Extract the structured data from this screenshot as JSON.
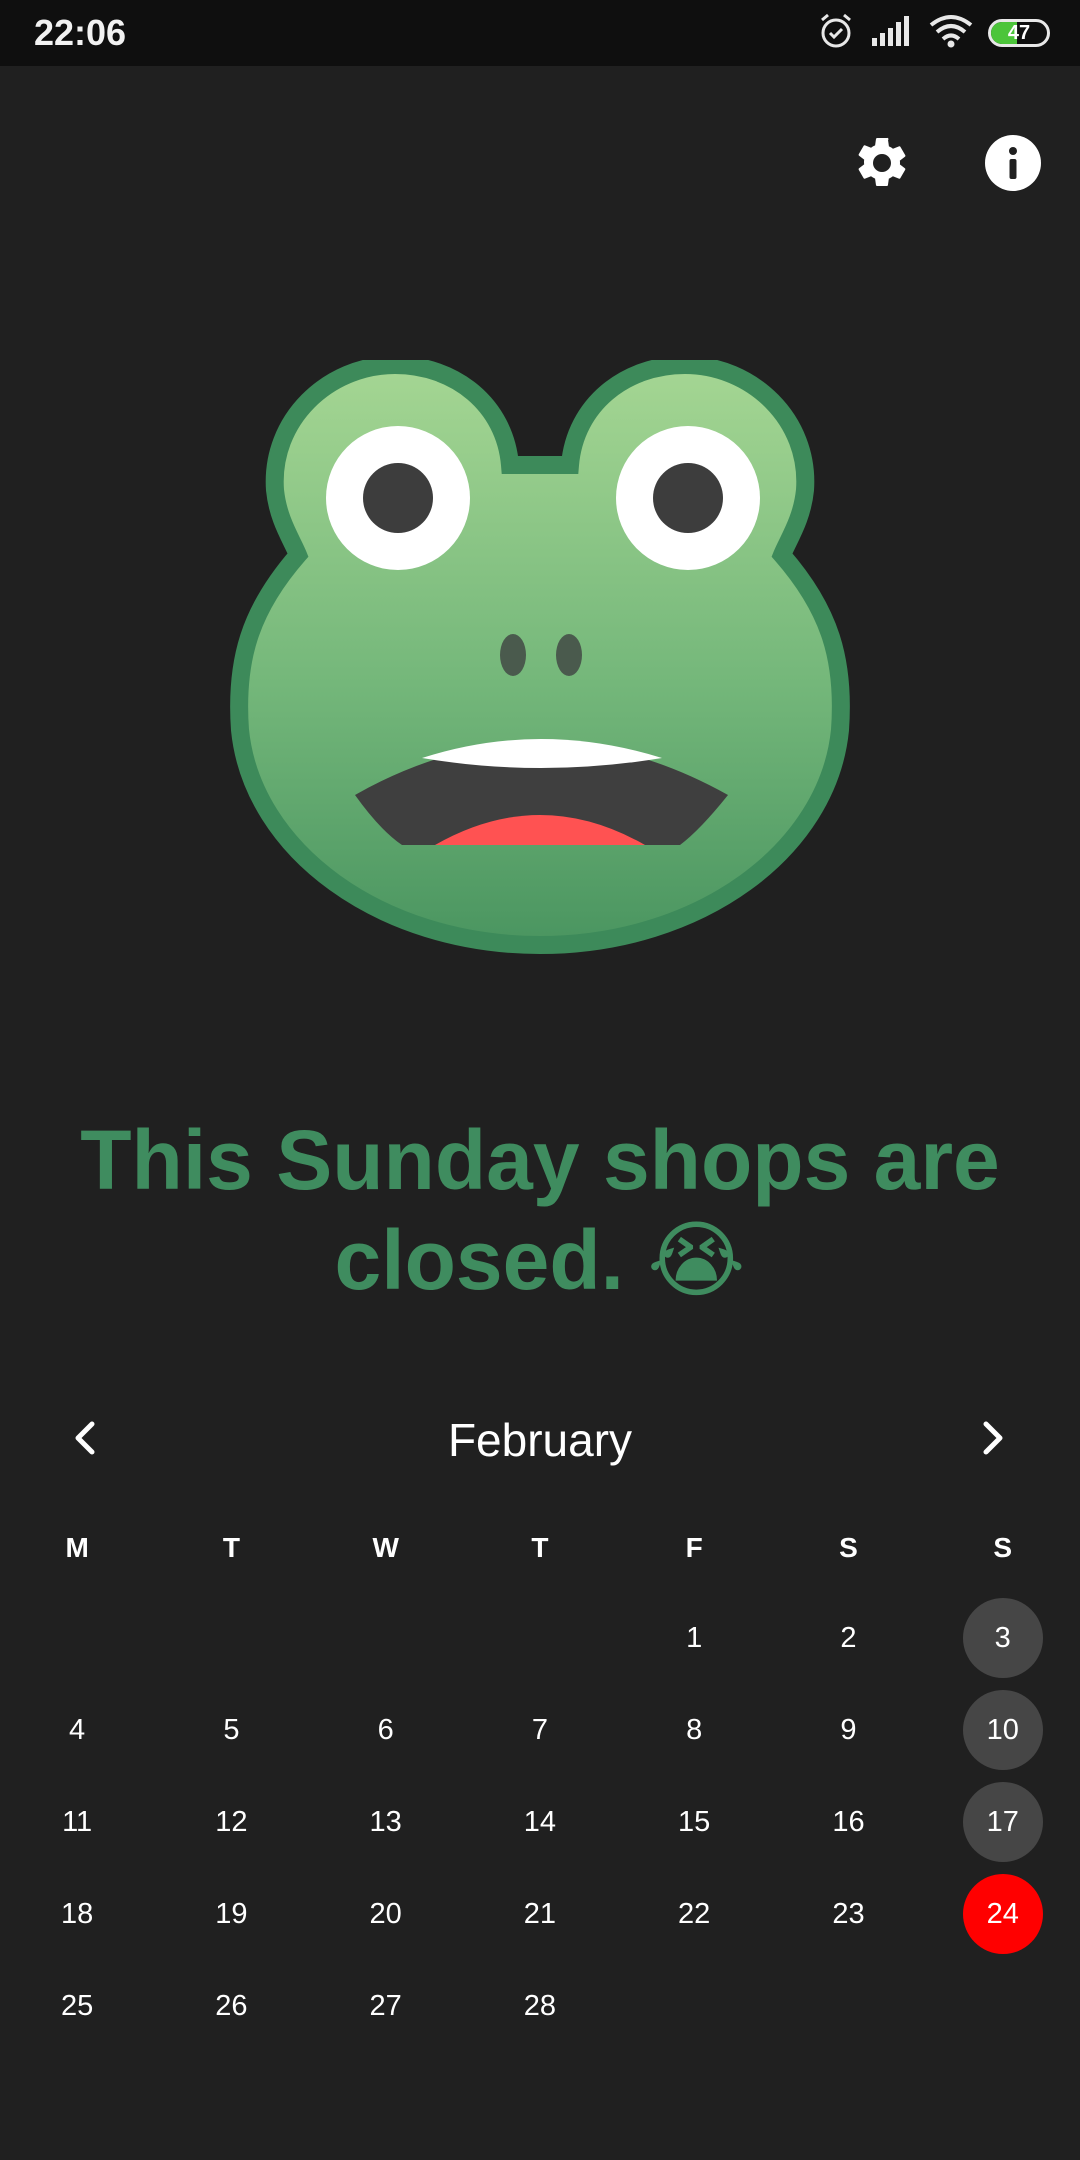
{
  "status_bar": {
    "time": "22:06",
    "battery_level": "47",
    "battery_fraction": 0.47,
    "icons": [
      "alarm-icon",
      "signal-icon",
      "wifi-icon",
      "battery-icon"
    ]
  },
  "toolbar": {
    "settings_icon": "gear-icon",
    "info_icon": "info-icon"
  },
  "hero": {
    "image": "frog-face",
    "message": "This Sunday shops are closed. 😭"
  },
  "calendar": {
    "month": "February",
    "prev_icon": "chevron-left-icon",
    "next_icon": "chevron-right-icon",
    "weekdays": [
      "M",
      "T",
      "W",
      "T",
      "F",
      "S",
      "S"
    ],
    "weeks": [
      [
        "",
        "",
        "",
        "",
        "1",
        "2",
        "3"
      ],
      [
        "4",
        "5",
        "6",
        "7",
        "8",
        "9",
        "10"
      ],
      [
        "11",
        "12",
        "13",
        "14",
        "15",
        "16",
        "17"
      ],
      [
        "18",
        "19",
        "20",
        "21",
        "22",
        "23",
        "24"
      ],
      [
        "25",
        "26",
        "27",
        "28",
        "",
        "",
        ""
      ]
    ],
    "highlighted_sundays": [
      "3",
      "10",
      "17"
    ],
    "selected_day": "24"
  },
  "colors": {
    "background": "#202020",
    "headline": "#3f8c5f",
    "sunday_circle": "#464646",
    "selected_circle": "#ff0000"
  }
}
